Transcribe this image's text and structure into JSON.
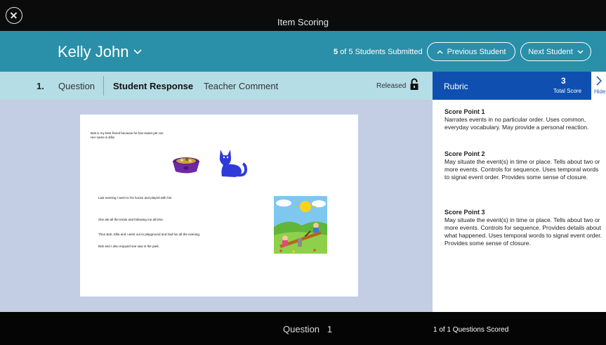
{
  "window": {
    "title": "Item Scoring"
  },
  "student": {
    "name": "Kelly John",
    "submitted_count": "5",
    "submitted_text": "of 5 Students Submitted",
    "prev_label": "Previous Student",
    "next_label": "Next Student"
  },
  "tabs": {
    "item_number": "1.",
    "question": "Question",
    "student_response": "Student Response",
    "teacher_comment": "Teacher Comment",
    "released": "Released"
  },
  "rubric": {
    "title": "Rubric",
    "total_score": "3",
    "total_score_label": "Total Score",
    "hide_label": "Hide",
    "score_points": [
      {
        "title": "Score Point 1",
        "text": "Narrates events in no particular order. Uses common, everyday vocabulary. May provide a personal reaction."
      },
      {
        "title": "Score Point 2",
        "text": "May situate the event(s) in time or place. Tells about two or more events. Controls for sequence. Uses temporal words to signal event order. Provides some sense of closure."
      },
      {
        "title": "Score Point 3",
        "text": "May situate the event(s) in time or place. Tells about two or more events. Controls for sequence. Provides details about what happened. Uses temporal words to signal event order. Provides some sense of closure."
      }
    ]
  },
  "response": {
    "line1": "Bob is my best friend because he has sweet pet cat.",
    "line2": "Her name is Ellie.",
    "line3": "Last evening I went to his house and played with her.",
    "line4": "She ate all the treats and following me all time.",
    "line5": "Then Bob, Ellie and I went out to playground and had fun all the evening.",
    "line6": "Bob and I also enjoyed see saw in the park."
  },
  "footer": {
    "question_label": "Question",
    "question_number": "1",
    "scored_text": "1 of 1 Questions Scored"
  },
  "colors": {
    "student_bar": "#2a8fa8",
    "tab_bar": "#b5dde5",
    "rubric_header": "#0f4fb0",
    "content_bg": "#c3cde4"
  },
  "icons": [
    "close-icon",
    "chevron-down-icon",
    "chevron-up-icon",
    "lock-icon",
    "chevron-right-icon"
  ]
}
